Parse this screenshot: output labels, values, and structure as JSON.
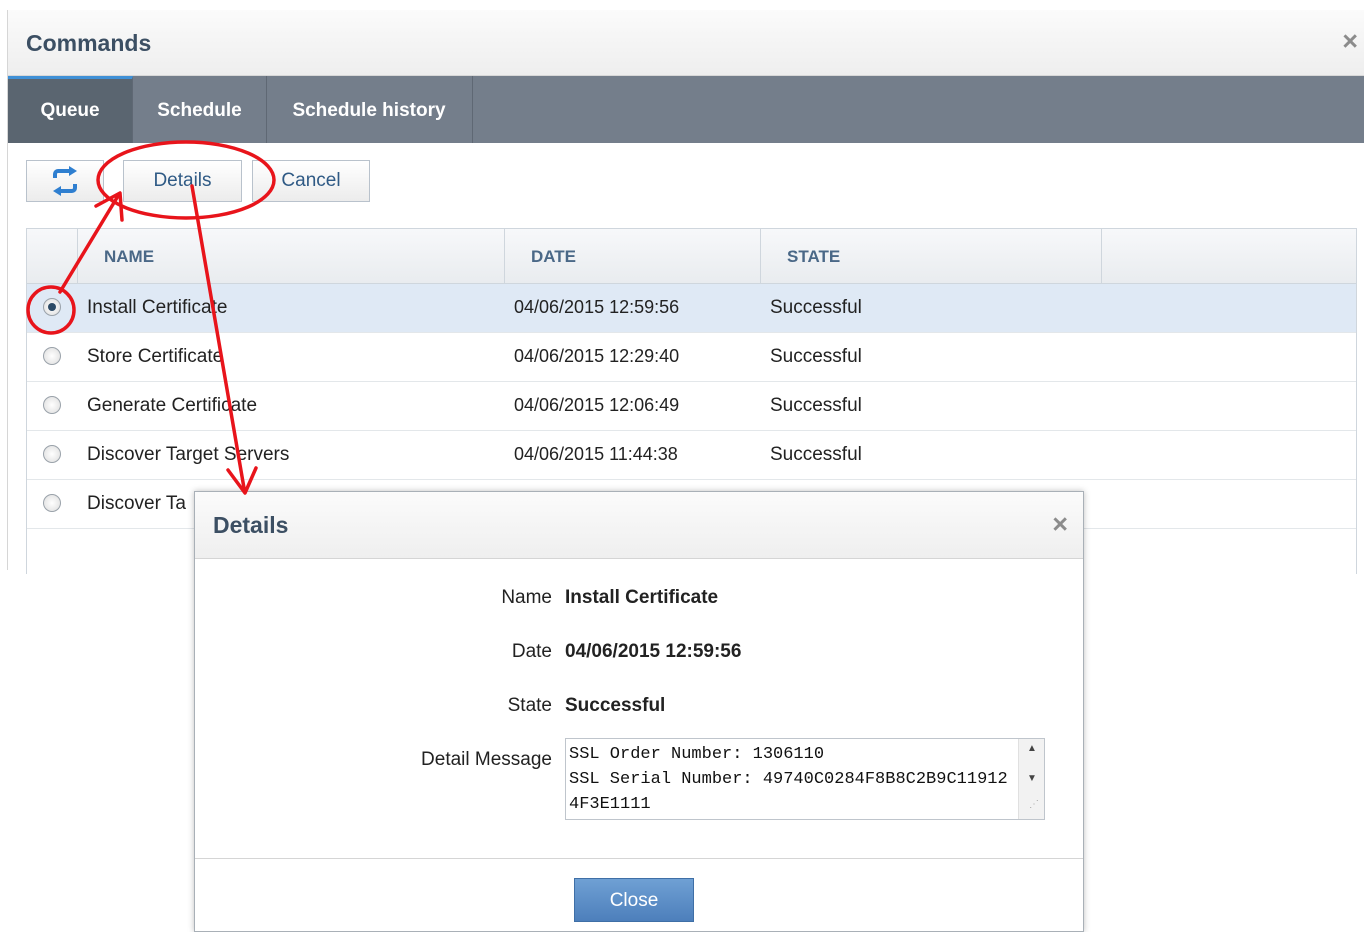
{
  "window": {
    "title": "Commands",
    "close_glyph": "×"
  },
  "tabs": [
    {
      "label": "Queue",
      "active": true
    },
    {
      "label": "Schedule",
      "active": false
    },
    {
      "label": "Schedule history",
      "active": false
    }
  ],
  "toolbar": {
    "refresh_icon": "refresh-icon",
    "details_label": "Details",
    "cancel_label": "Cancel"
  },
  "grid": {
    "columns": [
      "NAME",
      "DATE",
      "STATE"
    ],
    "rows": [
      {
        "name": "Install Certificate",
        "date": "04/06/2015 12:59:56",
        "state": "Successful",
        "selected": true
      },
      {
        "name": "Store Certificate",
        "date": "04/06/2015 12:29:40",
        "state": "Successful",
        "selected": false
      },
      {
        "name": "Generate Certificate",
        "date": "04/06/2015 12:06:49",
        "state": "Successful",
        "selected": false
      },
      {
        "name": "Discover Target Servers",
        "date": "04/06/2015 11:44:38",
        "state": "Successful",
        "selected": false
      },
      {
        "name": "Discover Ta",
        "date": "",
        "state": "",
        "selected": false
      }
    ]
  },
  "dialog": {
    "title": "Details",
    "close_glyph": "×",
    "fields": {
      "name_label": "Name",
      "name_value": "Install Certificate",
      "date_label": "Date",
      "date_value": "04/06/2015 12:59:56",
      "state_label": "State",
      "state_value": "Successful",
      "message_label": "Detail Message",
      "message_value": "SSL Order Number: 1306110\nSSL Serial Number: 49740C0284F8B8C2B9C119124F3E1111"
    },
    "close_label": "Close"
  },
  "colors": {
    "annotation": "#e8141b",
    "tab_bar": "#747e8b",
    "accent": "#3f90d6",
    "primary_button": "#5b8cc6"
  }
}
